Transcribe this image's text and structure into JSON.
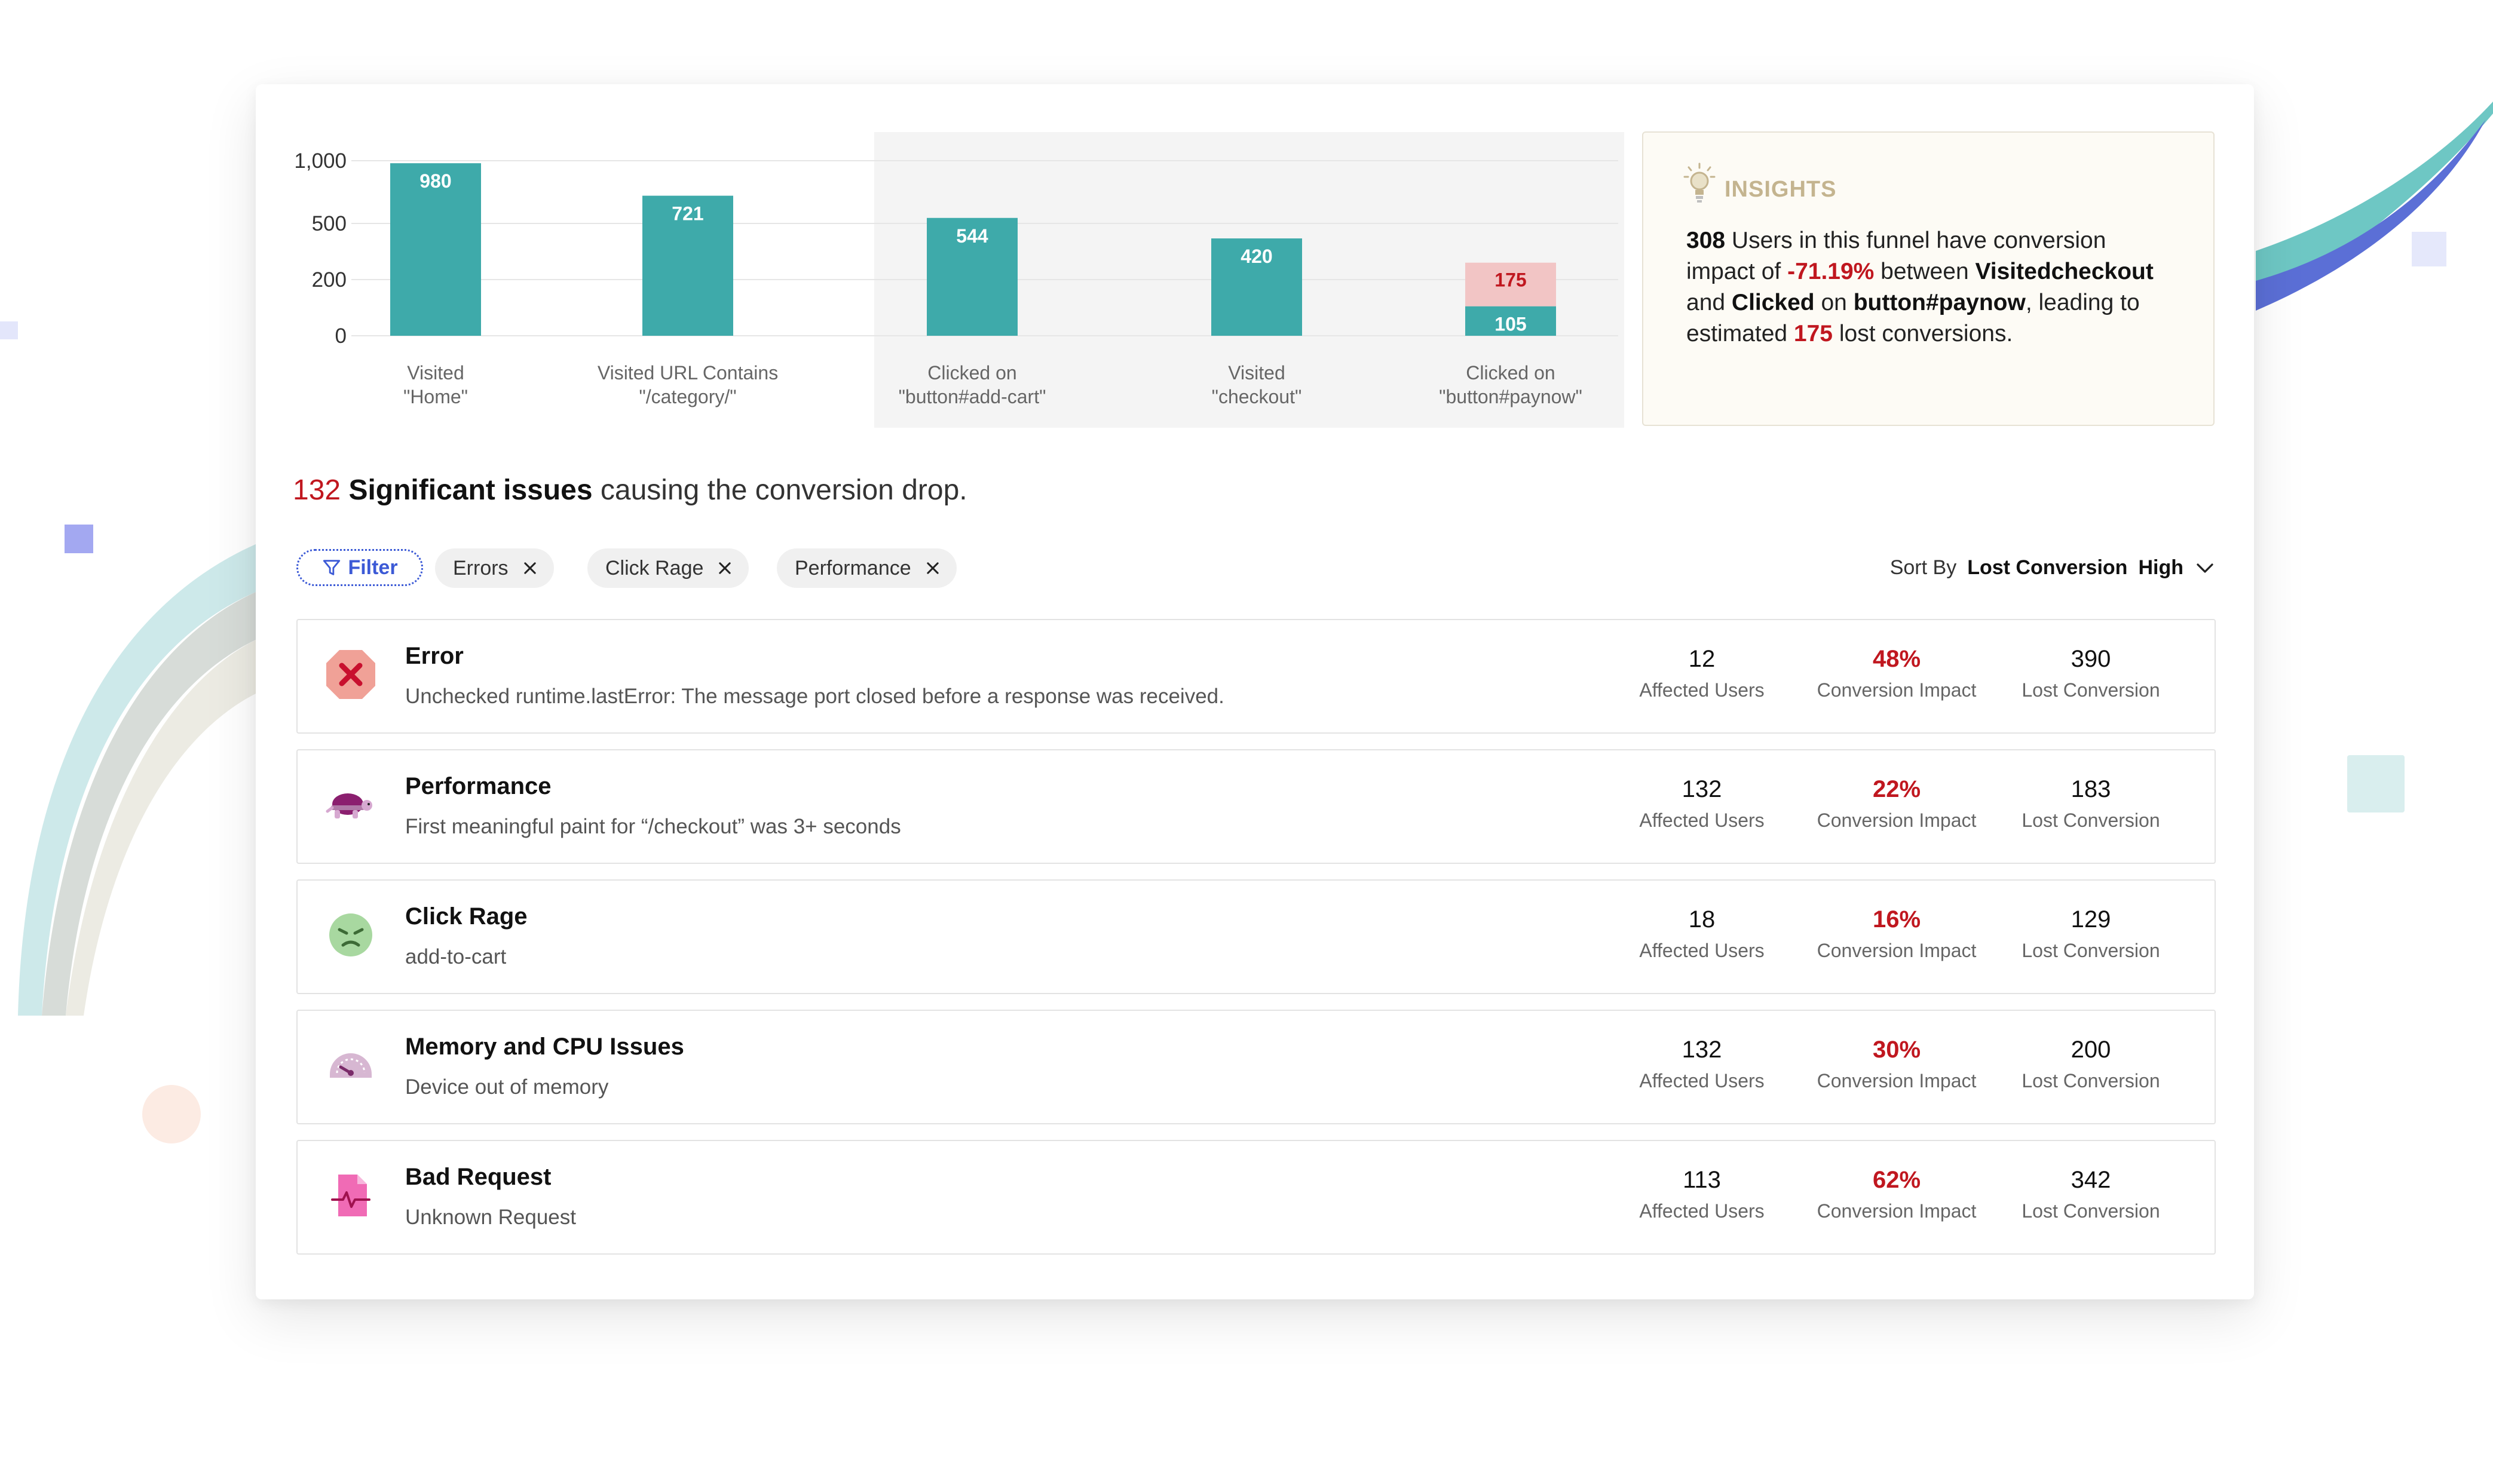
{
  "chart_data": {
    "type": "bar",
    "categories": [
      "Visited \"Home\"",
      "Visited URL Contains \"/category/\"",
      "Clicked on \"button#add-cart\"",
      "Visited \"checkout\"",
      "Clicked on \"button#paynow\""
    ],
    "category_lines": [
      [
        "Visited",
        "\"Home\""
      ],
      [
        "Visited URL Contains",
        "\"/category/\""
      ],
      [
        "Clicked on",
        "\"button#add-cart\""
      ],
      [
        "Visited",
        "\"checkout\""
      ],
      [
        "Clicked on",
        "\"button#paynow\""
      ]
    ],
    "values": [
      980,
      721,
      544,
      420,
      105
    ],
    "dropoff": {
      "category_index": 4,
      "value": 175
    },
    "y_ticks": [
      0,
      200,
      500,
      1000
    ],
    "y_tick_labels": [
      "0",
      "200",
      "500",
      "1,000"
    ],
    "highlight_categories": [
      2,
      3,
      4
    ],
    "colors": {
      "bar": "#3eaaaa",
      "dropoff": "#f2c5c5",
      "dropoff_text": "#c0171f",
      "highlight_bg": "#f4f4f4"
    }
  },
  "insights": {
    "title": "INSIGHTS",
    "users": "308",
    "t1": " Users in this funnel have conversion impact of ",
    "impact": "-71.19%",
    "t2": " between ",
    "step_a": "Visitedcheckout",
    "t3": " and ",
    "step_b": "Clicked",
    "t4": " on ",
    "target": "button#paynow",
    "t5": ", leading to estimated ",
    "lost": "175",
    "t6": " lost conversions."
  },
  "headline": {
    "count": "132",
    "strong": "Significant issues",
    "rest": " causing the conversion drop."
  },
  "filters": {
    "button_label": "Filter",
    "chips": [
      "Errors",
      "Click Rage",
      "Performance"
    ]
  },
  "sort": {
    "label": "Sort By",
    "value": "Lost Conversion",
    "order": "High"
  },
  "metric_labels": {
    "affected": "Affected Users",
    "impact": "Conversion Impact",
    "lost": "Lost Conversion"
  },
  "issues": [
    {
      "title": "Error",
      "desc": "Unchecked runtime.lastError: The message port closed before a response was received.",
      "affected": "12",
      "impact": "48%",
      "lost": "390",
      "icon": "error-icon"
    },
    {
      "title": "Performance",
      "desc": "First meaningful paint for “/checkout” was 3+ seconds",
      "affected": "132",
      "impact": "22%",
      "lost": "183",
      "icon": "turtle-icon"
    },
    {
      "title": "Click Rage",
      "desc": "add-to-cart",
      "affected": "18",
      "impact": "16%",
      "lost": "129",
      "icon": "angry-face-icon"
    },
    {
      "title": "Memory and CPU Issues",
      "desc": "Device out of memory",
      "affected": "132",
      "impact": "30%",
      "lost": "200",
      "icon": "gauge-icon"
    },
    {
      "title": "Bad Request",
      "desc": "Unknown Request",
      "affected": "113",
      "impact": "62%",
      "lost": "342",
      "icon": "file-pulse-icon"
    }
  ],
  "colors": {
    "accent": "#3c5ad6",
    "red": "#c0171f",
    "teal": "#3eaaaa"
  }
}
